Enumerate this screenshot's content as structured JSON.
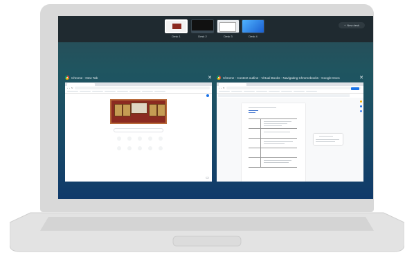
{
  "desks": [
    {
      "label": "Desk 1",
      "active": true
    },
    {
      "label": "Desk 2",
      "active": false
    },
    {
      "label": "Desk 3",
      "active": false
    },
    {
      "label": "Desk 4",
      "active": false
    }
  ],
  "new_desk_label": "New desk",
  "windows": [
    {
      "title": "Chrome - New Tab"
    },
    {
      "title": "Chrome - Content outline - Virtual Books - Navigating Chromebooks - Google Docs"
    }
  ]
}
